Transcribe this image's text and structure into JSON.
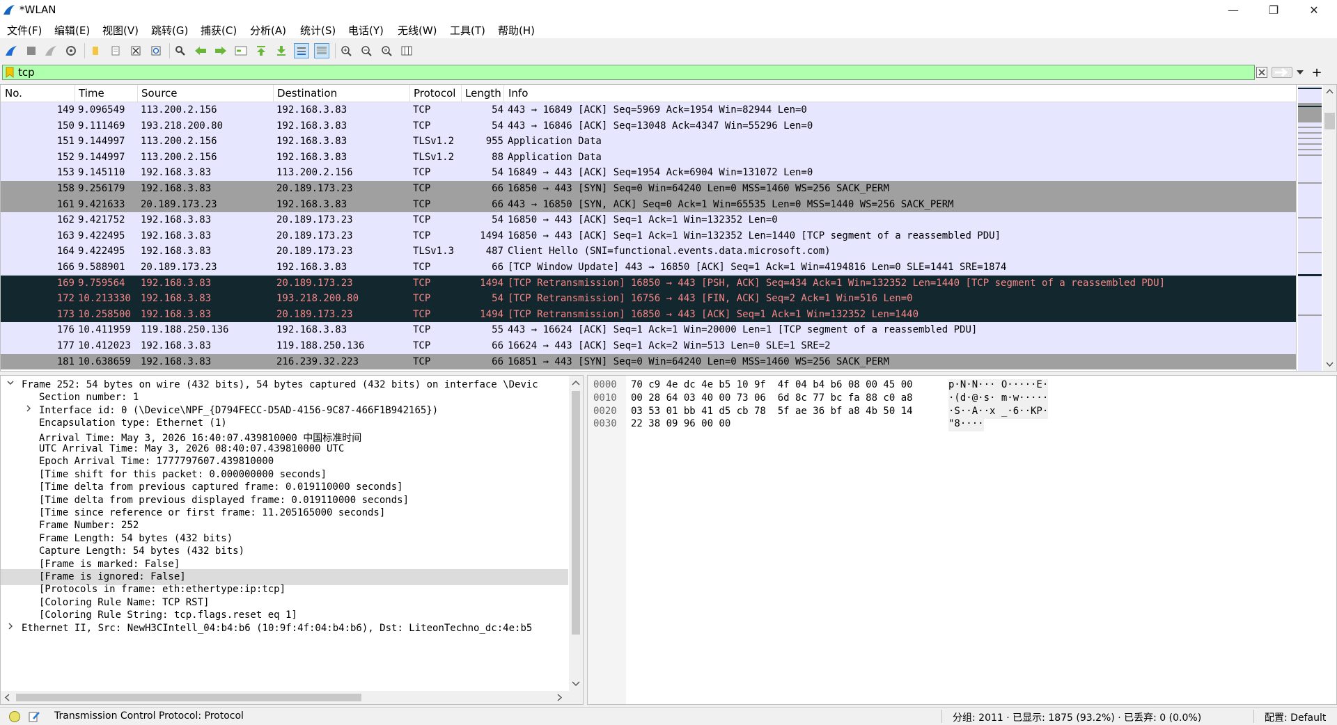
{
  "window": {
    "title": "*WLAN",
    "minimize": "—",
    "restore": "❐",
    "close": "✕"
  },
  "menu": [
    "文件(F)",
    "编辑(E)",
    "视图(V)",
    "跳转(G)",
    "捕获(C)",
    "分析(A)",
    "统计(S)",
    "电话(Y)",
    "无线(W)",
    "工具(T)",
    "帮助(H)"
  ],
  "filter": {
    "value": "tcp",
    "plus": "+"
  },
  "columns": [
    "No.",
    "Time",
    "Source",
    "Destination",
    "Protocol",
    "Length",
    "Info"
  ],
  "packets": [
    {
      "no": "149",
      "time": "9.096549",
      "src": "113.200.2.156",
      "dst": "192.168.3.83",
      "proto": "TCP",
      "len": "54",
      "info": "443 → 16849 [ACK] Seq=5969 Ack=1954 Win=82944 Len=0",
      "style": "tcp"
    },
    {
      "no": "150",
      "time": "9.111469",
      "src": "193.218.200.80",
      "dst": "192.168.3.83",
      "proto": "TCP",
      "len": "54",
      "info": "443 → 16846 [ACK] Seq=13048 Ack=4347 Win=55296 Len=0",
      "style": "tcp"
    },
    {
      "no": "151",
      "time": "9.144997",
      "src": "113.200.2.156",
      "dst": "192.168.3.83",
      "proto": "TLSv1.2",
      "len": "955",
      "info": "Application Data",
      "style": "tcp"
    },
    {
      "no": "152",
      "time": "9.144997",
      "src": "113.200.2.156",
      "dst": "192.168.3.83",
      "proto": "TLSv1.2",
      "len": "88",
      "info": "Application Data",
      "style": "tcp"
    },
    {
      "no": "153",
      "time": "9.145110",
      "src": "192.168.3.83",
      "dst": "113.200.2.156",
      "proto": "TCP",
      "len": "54",
      "info": "16849 → 443 [ACK] Seq=1954 Ack=6904 Win=131072 Len=0",
      "style": "tcp"
    },
    {
      "no": "158",
      "time": "9.256179",
      "src": "192.168.3.83",
      "dst": "20.189.173.23",
      "proto": "TCP",
      "len": "66",
      "info": "16850 → 443 [SYN] Seq=0 Win=64240 Len=0 MSS=1460 WS=256 SACK_PERM",
      "style": "syn"
    },
    {
      "no": "161",
      "time": "9.421633",
      "src": "20.189.173.23",
      "dst": "192.168.3.83",
      "proto": "TCP",
      "len": "66",
      "info": "443 → 16850 [SYN, ACK] Seq=0 Ack=1 Win=65535 Len=0 MSS=1440 WS=256 SACK_PERM",
      "style": "syn"
    },
    {
      "no": "162",
      "time": "9.421752",
      "src": "192.168.3.83",
      "dst": "20.189.173.23",
      "proto": "TCP",
      "len": "54",
      "info": "16850 → 443 [ACK] Seq=1 Ack=1 Win=132352 Len=0",
      "style": "tcp"
    },
    {
      "no": "163",
      "time": "9.422495",
      "src": "192.168.3.83",
      "dst": "20.189.173.23",
      "proto": "TCP",
      "len": "1494",
      "info": "16850 → 443 [ACK] Seq=1 Ack=1 Win=132352 Len=1440 [TCP segment of a reassembled PDU]",
      "style": "tcp"
    },
    {
      "no": "164",
      "time": "9.422495",
      "src": "192.168.3.83",
      "dst": "20.189.173.23",
      "proto": "TLSv1.3",
      "len": "487",
      "info": "Client Hello (SNI=functional.events.data.microsoft.com)",
      "style": "tcp"
    },
    {
      "no": "166",
      "time": "9.588901",
      "src": "20.189.173.23",
      "dst": "192.168.3.83",
      "proto": "TCP",
      "len": "66",
      "info": "[TCP Window Update] 443 → 16850 [ACK] Seq=1 Ack=1 Win=4194816 Len=0 SLE=1441 SRE=1874",
      "style": "tcp"
    },
    {
      "no": "169",
      "time": "9.759564",
      "src": "192.168.3.83",
      "dst": "20.189.173.23",
      "proto": "TCP",
      "len": "1494",
      "info": "[TCP Retransmission] 16850 → 443 [PSH, ACK] Seq=434 Ack=1 Win=132352 Len=1440 [TCP segment of a reassembled PDU]",
      "style": "bad"
    },
    {
      "no": "172",
      "time": "10.213330",
      "src": "192.168.3.83",
      "dst": "193.218.200.80",
      "proto": "TCP",
      "len": "54",
      "info": "[TCP Retransmission] 16756 → 443 [FIN, ACK] Seq=2 Ack=1 Win=516 Len=0",
      "style": "bad"
    },
    {
      "no": "173",
      "time": "10.258500",
      "src": "192.168.3.83",
      "dst": "20.189.173.23",
      "proto": "TCP",
      "len": "1494",
      "info": "[TCP Retransmission] 16850 → 443 [ACK] Seq=1 Ack=1 Win=132352 Len=1440",
      "style": "bad"
    },
    {
      "no": "176",
      "time": "10.411959",
      "src": "119.188.250.136",
      "dst": "192.168.3.83",
      "proto": "TCP",
      "len": "55",
      "info": "443 → 16624 [ACK] Seq=1 Ack=1 Win=20000 Len=1 [TCP segment of a reassembled PDU]",
      "style": "tcp"
    },
    {
      "no": "177",
      "time": "10.412023",
      "src": "192.168.3.83",
      "dst": "119.188.250.136",
      "proto": "TCP",
      "len": "66",
      "info": "16624 → 443 [ACK] Seq=1 Ack=2 Win=513 Len=0 SLE=1 SRE=2",
      "style": "tcp"
    },
    {
      "no": "181",
      "time": "10.638659",
      "src": "192.168.3.83",
      "dst": "216.239.32.223",
      "proto": "TCP",
      "len": "66",
      "info": "16851 → 443 [SYN] Seq=0 Win=64240 Len=0 MSS=1460 WS=256 SACK_PERM",
      "style": "syn"
    }
  ],
  "details": [
    {
      "text": "Frame 252: 54 bytes on wire (432 bits), 54 bytes captured (432 bits) on interface \\Devic",
      "indent": 0,
      "arrow": "v"
    },
    {
      "text": "Section number: 1",
      "indent": 1,
      "arrow": ""
    },
    {
      "text": "Interface id: 0 (\\Device\\NPF_{D794FECC-D5AD-4156-9C87-466F1B942165})",
      "indent": 1,
      "arrow": ">"
    },
    {
      "text": "Encapsulation type: Ethernet (1)",
      "indent": 1,
      "arrow": ""
    },
    {
      "text": "Arrival Time: May  3, 2026 16:40:07.439810000 中国标准时间",
      "indent": 1,
      "arrow": ""
    },
    {
      "text": "UTC Arrival Time: May  3, 2026 08:40:07.439810000 UTC",
      "indent": 1,
      "arrow": ""
    },
    {
      "text": "Epoch Arrival Time: 1777797607.439810000",
      "indent": 1,
      "arrow": ""
    },
    {
      "text": "[Time shift for this packet: 0.000000000 seconds]",
      "indent": 1,
      "arrow": ""
    },
    {
      "text": "[Time delta from previous captured frame: 0.019110000 seconds]",
      "indent": 1,
      "arrow": ""
    },
    {
      "text": "[Time delta from previous displayed frame: 0.019110000 seconds]",
      "indent": 1,
      "arrow": ""
    },
    {
      "text": "[Time since reference or first frame: 11.205165000 seconds]",
      "indent": 1,
      "arrow": ""
    },
    {
      "text": "Frame Number: 252",
      "indent": 1,
      "arrow": ""
    },
    {
      "text": "Frame Length: 54 bytes (432 bits)",
      "indent": 1,
      "arrow": ""
    },
    {
      "text": "Capture Length: 54 bytes (432 bits)",
      "indent": 1,
      "arrow": ""
    },
    {
      "text": "[Frame is marked: False]",
      "indent": 1,
      "arrow": ""
    },
    {
      "text": "[Frame is ignored: False]",
      "indent": 1,
      "arrow": "",
      "selected": true
    },
    {
      "text": "[Protocols in frame: eth:ethertype:ip:tcp]",
      "indent": 1,
      "arrow": ""
    },
    {
      "text": "[Coloring Rule Name: TCP RST]",
      "indent": 1,
      "arrow": ""
    },
    {
      "text": "[Coloring Rule String: tcp.flags.reset eq 1]",
      "indent": 1,
      "arrow": ""
    },
    {
      "text": "Ethernet II, Src: NewH3CIntell_04:b4:b6 (10:9f:4f:04:b4:b6), Dst: LiteonTechno_dc:4e:b5",
      "indent": 0,
      "arrow": ">"
    }
  ],
  "bytes": [
    {
      "offset": "0000",
      "hex": "70 c9 4e dc 4e b5 10 9f  4f 04 b4 b6 08 00 45 00",
      "ascii": "p·N·N··· O·····E·"
    },
    {
      "offset": "0010",
      "hex": "00 28 64 03 40 00 73 06  6d 8c 77 bc fa 88 c0 a8",
      "ascii": "·(d·@·s· m·w·····"
    },
    {
      "offset": "0020",
      "hex": "03 53 01 bb 41 d5 cb 78  5f ae 36 bf a8 4b 50 14",
      "ascii": "·S··A··x _·6··KP·"
    },
    {
      "offset": "0030",
      "hex": "22 38 09 96 00 00",
      "ascii": "\"8····"
    }
  ],
  "status": {
    "text": "Transmission Control Protocol: Protocol",
    "packets": "分组: 2011 · 已显示: 1875 (93.2%) · 已丢弃: 0 (0.0%)",
    "profile": "配置: Default"
  },
  "colors": {
    "tcp_row": "#e7e6ff",
    "syn_row": "#a0a0a0",
    "bad_row_bg": "#12272e",
    "bad_row_fg": "#f78787",
    "filter_ok": "#afffaf"
  }
}
